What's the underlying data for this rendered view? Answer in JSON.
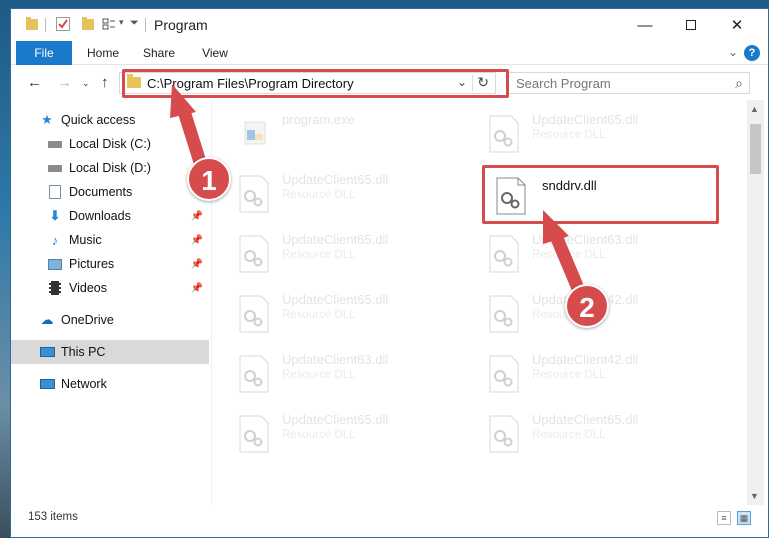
{
  "window": {
    "title": "Program"
  },
  "ribbon": {
    "tabs": [
      "File",
      "Home",
      "Share",
      "View"
    ],
    "help": "?"
  },
  "nav": {
    "address": "C:\\Program Files\\Program Directory",
    "search_placeholder": "Search Program"
  },
  "sidebar": {
    "items": [
      {
        "label": "Quick access",
        "pinned": false
      },
      {
        "label": "Local Disk (C:)",
        "pinned": false
      },
      {
        "label": "Local Disk (D:)",
        "pinned": false
      },
      {
        "label": "Documents",
        "pinned": false
      },
      {
        "label": "Downloads",
        "pinned": true
      },
      {
        "label": "Music",
        "pinned": true
      },
      {
        "label": "Pictures",
        "pinned": true
      },
      {
        "label": "Videos",
        "pinned": true
      },
      {
        "label": "OneDrive",
        "pinned": false
      },
      {
        "label": "This PC",
        "pinned": false,
        "active": true
      },
      {
        "label": "Network",
        "pinned": false
      }
    ]
  },
  "files": [
    {
      "name": "program.exe",
      "type": ""
    },
    {
      "name": "UpdateClient65.dll",
      "type": "Resource DLL"
    },
    {
      "name": "UpdateClient65.dll",
      "type": "Resource DLL"
    },
    {
      "name": "snddrv.dll",
      "type": "",
      "selected": true
    },
    {
      "name": "UpdateClient65.dll",
      "type": "Resource DLL"
    },
    {
      "name": "UpdateClient63.dll",
      "type": "Resource DLL"
    },
    {
      "name": "UpdateClient65.dll",
      "type": "Resource DLL"
    },
    {
      "name": "UpdateClient42.dll",
      "type": "Resource DLL"
    },
    {
      "name": "UpdateClient63.dll",
      "type": "Resource DLL"
    },
    {
      "name": "UpdateClient42.dll",
      "type": "Resource DLL"
    },
    {
      "name": "UpdateClient65.dll",
      "type": "Resource DLL"
    },
    {
      "name": "UpdateClient65.dll",
      "type": "Resource DLL"
    }
  ],
  "status": {
    "count": "153 items"
  },
  "annotations": {
    "step1": "1",
    "step2": "2",
    "color": "#d64b4b"
  },
  "colors": {
    "accent": "#1979ca",
    "highlight": "#d64b4b"
  }
}
